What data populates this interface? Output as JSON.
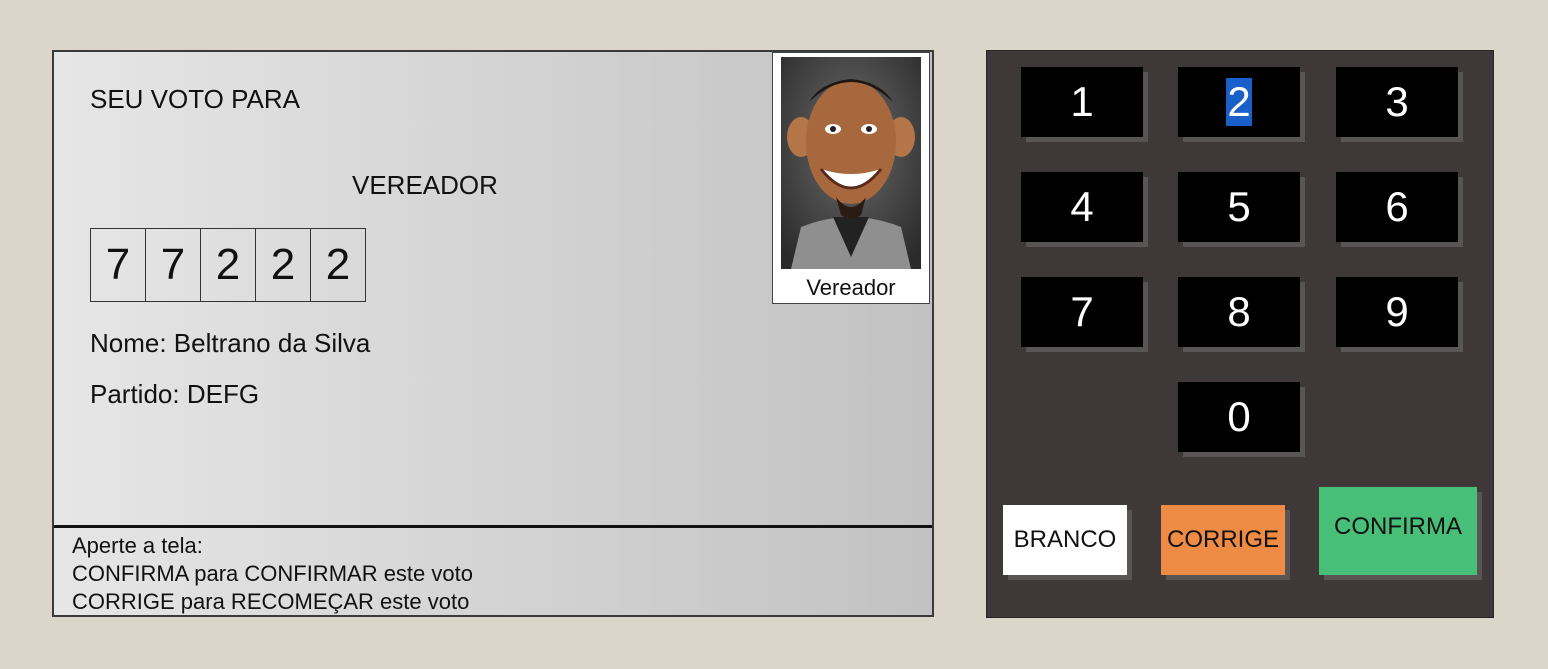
{
  "screen": {
    "title": "SEU VOTO PARA",
    "role": "VEREADOR",
    "digits": [
      "7",
      "7",
      "2",
      "2",
      "2"
    ],
    "name_line": "Nome: Beltrano da Silva",
    "party_line": "Partido: DEFG",
    "photo_caption": "Vereador",
    "footer": {
      "line1": "Aperte a tela:",
      "line2": "CONFIRMA para CONFIRMAR este voto",
      "line3": "CORRIGE para RECOMEÇAR este voto"
    }
  },
  "keypad": {
    "keys": [
      "1",
      "2",
      "3",
      "4",
      "5",
      "6",
      "7",
      "8",
      "9",
      "0"
    ],
    "branco": "BRANCO",
    "corrige": "CORRIGE",
    "confirma": "CONFIRMA"
  },
  "colors": {
    "background": "#dcd5ca",
    "keypad": "#3e3838",
    "corrige": "#ee8c45",
    "confirma": "#47bf78"
  }
}
